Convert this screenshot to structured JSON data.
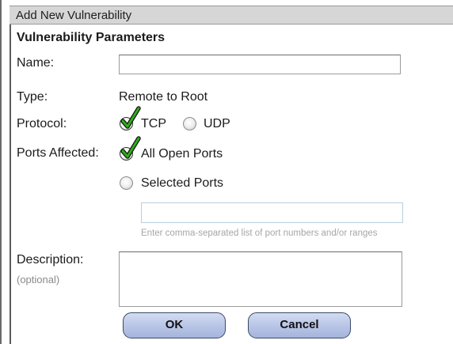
{
  "dialog": {
    "title": "Add New Vulnerability",
    "section_title": "Vulnerability Parameters"
  },
  "form": {
    "name": {
      "label": "Name:",
      "value": ""
    },
    "type": {
      "label": "Type:",
      "value": "Remote to Root"
    },
    "protocol": {
      "label": "Protocol:",
      "options": [
        {
          "label": "TCP",
          "selected": true
        },
        {
          "label": "UDP",
          "selected": false
        }
      ]
    },
    "ports": {
      "label": "Ports Affected:",
      "options": [
        {
          "label": "All Open Ports",
          "selected": true
        },
        {
          "label": "Selected Ports",
          "selected": false
        }
      ],
      "selected_ports_value": "",
      "hint": "Enter comma-separated list of port numbers and/or ranges"
    },
    "description": {
      "label": "Description:",
      "sublabel": "(optional)",
      "value": ""
    }
  },
  "buttons": {
    "ok": "OK",
    "cancel": "Cancel"
  },
  "colors": {
    "check": "#2fae19",
    "button": "#b7c4e6",
    "title_bg": "#d6d6d6"
  }
}
